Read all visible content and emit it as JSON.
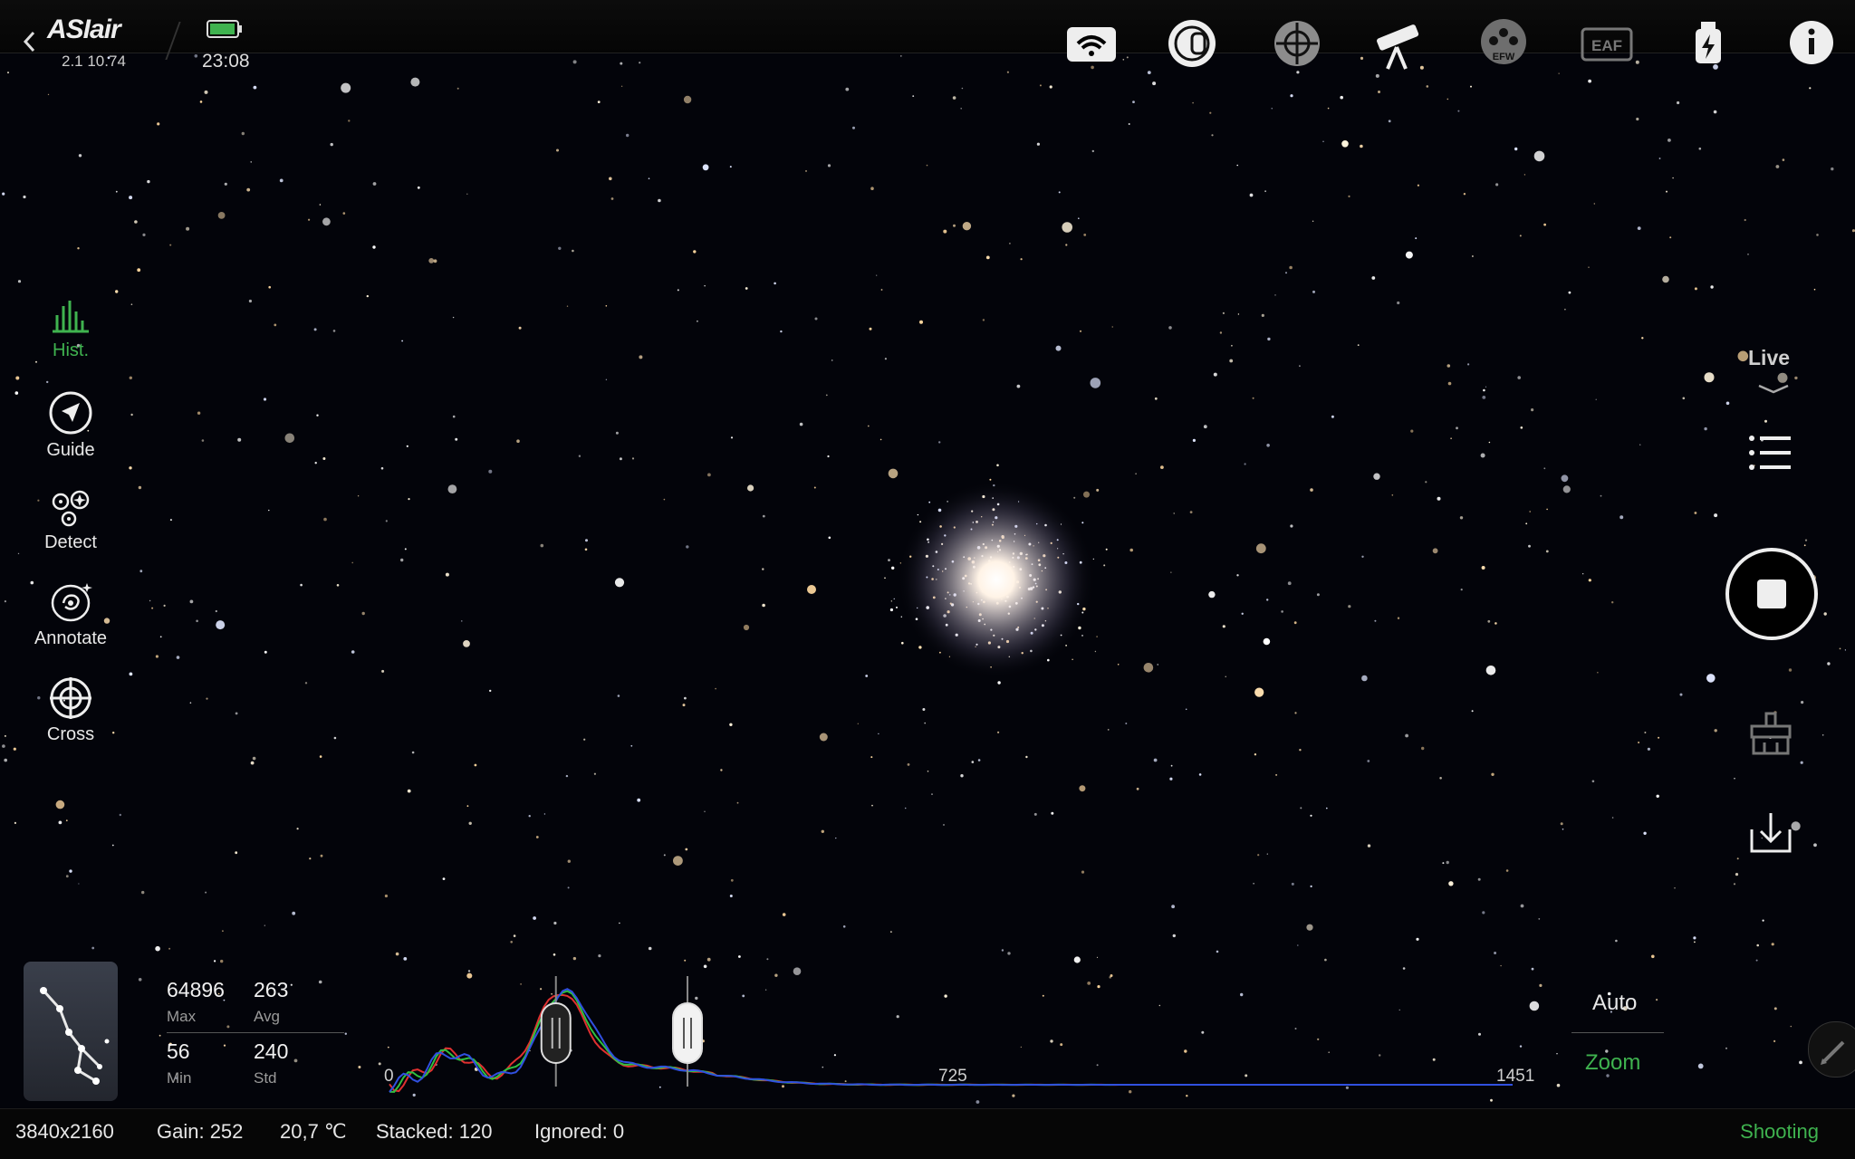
{
  "header": {
    "logo": "ASIair",
    "version": "2.1 10.74",
    "time": "23:08",
    "devices": [
      {
        "id": "wifi",
        "icon": "wifi-icon"
      },
      {
        "id": "camera",
        "icon": "camera-icon"
      },
      {
        "id": "guide-camera",
        "icon": "guide-camera-icon"
      },
      {
        "id": "telescope",
        "icon": "telescope-icon"
      },
      {
        "id": "efw",
        "icon": "efw-icon",
        "label": "EFW"
      },
      {
        "id": "eaf",
        "icon": "eaf-icon",
        "label": "EAF"
      },
      {
        "id": "power",
        "icon": "power-icon"
      },
      {
        "id": "info",
        "icon": "info-icon"
      }
    ],
    "accent": "#3fb34f"
  },
  "tools": [
    {
      "id": "hist",
      "label": "Hist.",
      "icon": "histogram-icon",
      "active": true
    },
    {
      "id": "guide",
      "label": "Guide",
      "icon": "guide-arrow-icon",
      "active": false
    },
    {
      "id": "detect",
      "label": "Detect",
      "icon": "detect-stars-icon",
      "active": false
    },
    {
      "id": "annotate",
      "label": "Annotate",
      "icon": "galaxy-icon",
      "active": false
    },
    {
      "id": "cross",
      "label": "Cross",
      "icon": "crosshair-icon",
      "active": false
    }
  ],
  "right_panel": {
    "mode": "Live",
    "controls": [
      "list-icon",
      "stop-icon",
      "brush-icon",
      "download-icon"
    ]
  },
  "stats": {
    "max": {
      "value": "64896",
      "label": "Max"
    },
    "avg": {
      "value": "263",
      "label": "Avg"
    },
    "min": {
      "value": "56",
      "label": "Min"
    },
    "std": {
      "value": "240",
      "label": "Std"
    }
  },
  "histogram": {
    "axis_labels": [
      "0",
      "725",
      "1451"
    ],
    "range": [
      0,
      1451
    ],
    "black_point": 215,
    "white_point": 385,
    "series_colors": [
      "#e03030",
      "#30c040",
      "#3050e0"
    ]
  },
  "zoom_panel": {
    "auto": "Auto",
    "zoom": "Zoom"
  },
  "status": {
    "resolution": "3840x2160",
    "gain": "Gain: 252",
    "temperature": "20,7 ℃",
    "stacked": "Stacked: 120",
    "ignored": "Ignored: 0",
    "state": "Shooting"
  }
}
